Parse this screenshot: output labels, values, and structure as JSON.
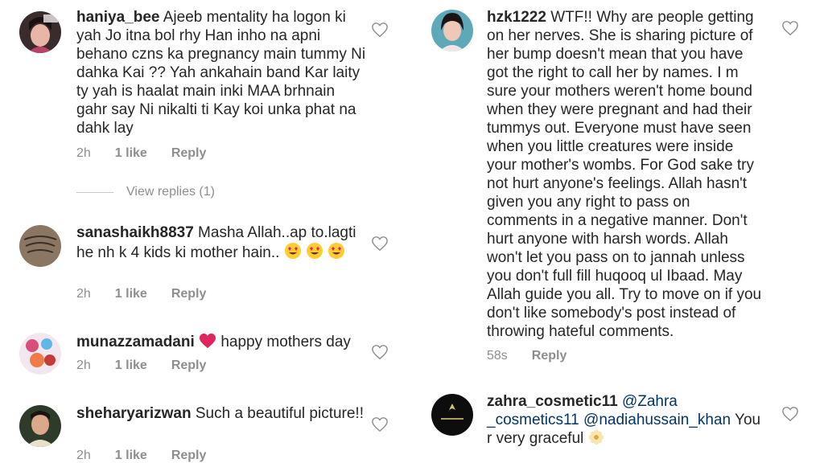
{
  "left_comments": [
    {
      "username": "haniya_bee",
      "text": "Ajeeb mentality ha logon ki yah Jo itna bol rhy Han inho na apni behano czns ka pregnancy main tummy Ni dahka Kai ?? Yah ankahain band Kar laity ty yah is haalat main inki MAA brhnain gahr say Ni nikalti ti Kay koi unka phat na dahk lay",
      "time": "2h",
      "likes": "1 like",
      "reply": "Reply",
      "view_replies": "View replies (1)"
    },
    {
      "username": "sanashaikh8837",
      "text": "Masha Allah..ap to.lagti he nh k 4 kids ki mother hain..",
      "time": "2h",
      "likes": "1 like",
      "reply": "Reply"
    },
    {
      "username": "munazzamadani",
      "text": "happy mothers day",
      "time": "2h",
      "likes": "1 like",
      "reply": "Reply"
    },
    {
      "username": "sheharyarizwan",
      "text": "Such a beautiful picture!!",
      "time": "2h",
      "likes": "1 like",
      "reply": "Reply"
    }
  ],
  "right_comments": [
    {
      "username": "hzk1222",
      "text": "WTF!! Why are people getting on her nerves. She is sharing picture of her bump doesn't mean that you have got the right to call her by names. I m sure your mothers weren't home bound when they were pregnant and had their tummys out. Everyone must have seen when you little creatures were inside your mother's wombs. For God sake try not hurt anyone's feelings. Allah hasn't given you any right to pass on comments in a negative manner. Don't hurt anyone with harsh words. Allah won't let you pass on to jannah unless you don't full fill huqooq ul Ibaad. May Allah guide you all. Try to move on if you don't like somebody's post instead of throwing hateful comments.",
      "time": "58s",
      "reply": "Reply"
    },
    {
      "username": "zahra_cosmetic11",
      "mention1": "@Zahra _cosmetics11",
      "mention2": "@nadiahussain_khan",
      "text": "You r very graceful"
    }
  ],
  "icons": {
    "heart": "heart-outline-icon",
    "red_heart": "red-heart-emoji",
    "heart_eyes": "heart-eyes-emoji",
    "flower": "blossom-emoji"
  },
  "colors": {
    "text": "#262626",
    "meta": "#8e8e8e",
    "mention": "#003569",
    "heart_outline": "#8e8e8e"
  }
}
